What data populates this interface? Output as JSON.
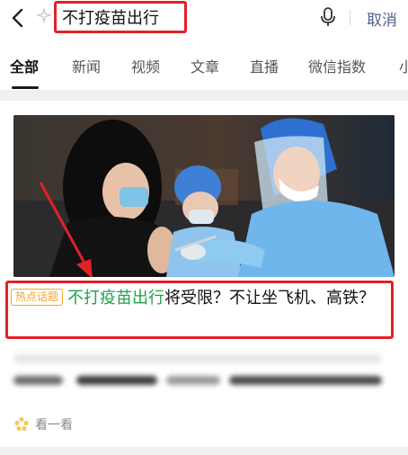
{
  "search": {
    "query": "不打疫苗出行",
    "cancel_label": "取消"
  },
  "tabs": [
    {
      "label": "全部"
    },
    {
      "label": "新闻"
    },
    {
      "label": "视频"
    },
    {
      "label": "文章"
    },
    {
      "label": "直播"
    },
    {
      "label": "微信指数"
    },
    {
      "label": "小"
    }
  ],
  "article": {
    "badge": "热点话题",
    "title_highlight": "不打疫苗出行",
    "title_rest": "将受限？不让坐飞机、高铁？"
  },
  "more": {
    "label": "看一看"
  },
  "colors": {
    "annotation_red": "#e32028",
    "highlight_green": "#21a04b",
    "badge_orange": "#f2a42c",
    "cancel_blue": "#4e5f88"
  },
  "icons": [
    "back-arrow-icon",
    "sparkle-icon",
    "microphone-icon",
    "look-icon"
  ]
}
